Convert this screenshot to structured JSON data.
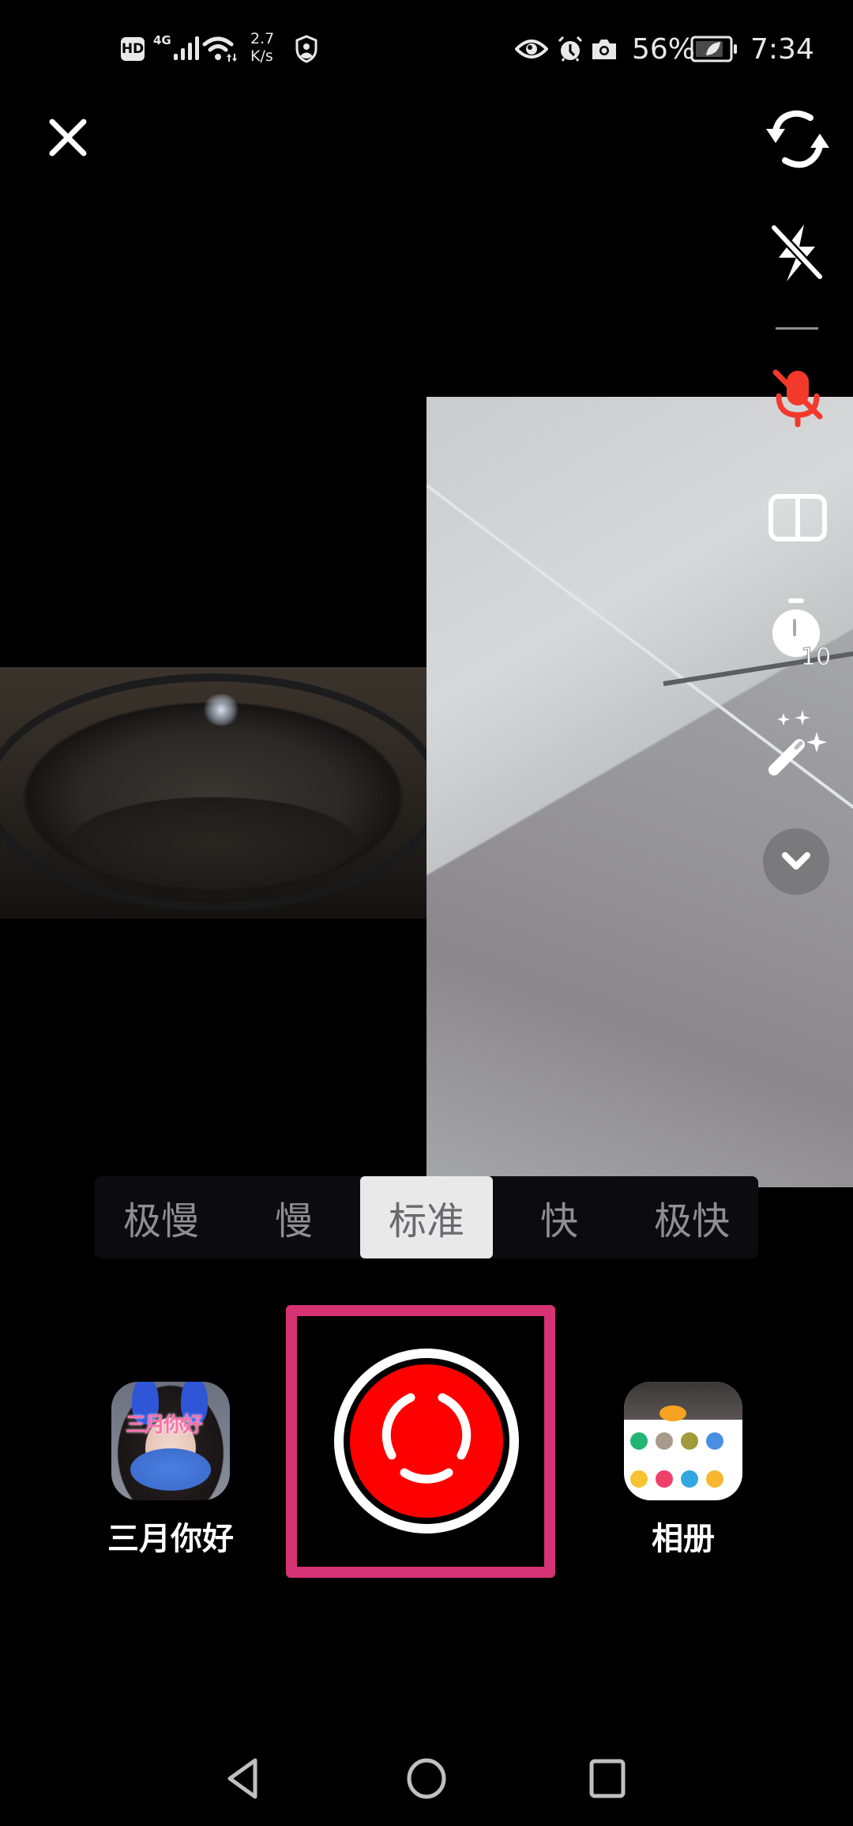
{
  "status_bar": {
    "left_icons": [
      "hd-voice-icon",
      "4g-signal-icon",
      "wifi-icon",
      "shield-user-icon"
    ],
    "network_type": "4G",
    "hd_label": "HD",
    "net_speed_value": "2.7",
    "net_speed_unit": "K/s",
    "right_icons": [
      "eye-comfort-icon",
      "alarm-icon",
      "camera-in-use-icon",
      "battery-saver-icon"
    ],
    "battery_percent": "56%",
    "time": "7:34"
  },
  "top_bar": {
    "close_icon": "close-icon",
    "side_tools": [
      {
        "name": "flip-camera",
        "icon": "flip-camera-icon"
      },
      {
        "name": "flash-off",
        "icon": "flash-off-icon"
      },
      {
        "name": "mic-muted",
        "icon": "mic-off-icon",
        "color": "#f2392c"
      },
      {
        "name": "split-layout",
        "icon": "split-layout-icon"
      },
      {
        "name": "timer",
        "icon": "timer-icon",
        "badge": "10"
      },
      {
        "name": "beauty",
        "icon": "magic-wand-icon"
      },
      {
        "name": "more",
        "icon": "chevron-down-icon"
      }
    ]
  },
  "speed_selector": {
    "options": [
      "极慢",
      "慢",
      "标准",
      "快",
      "极快"
    ],
    "selected": "标准"
  },
  "record": {
    "effect_label": "三月你好",
    "effect_thumb_text": "三月你好",
    "album_label": "相册",
    "highlight_color": "#d63374",
    "record_color": "#fe0000"
  },
  "nav_bar": {
    "buttons": [
      "back-icon",
      "home-icon",
      "recents-icon"
    ]
  }
}
